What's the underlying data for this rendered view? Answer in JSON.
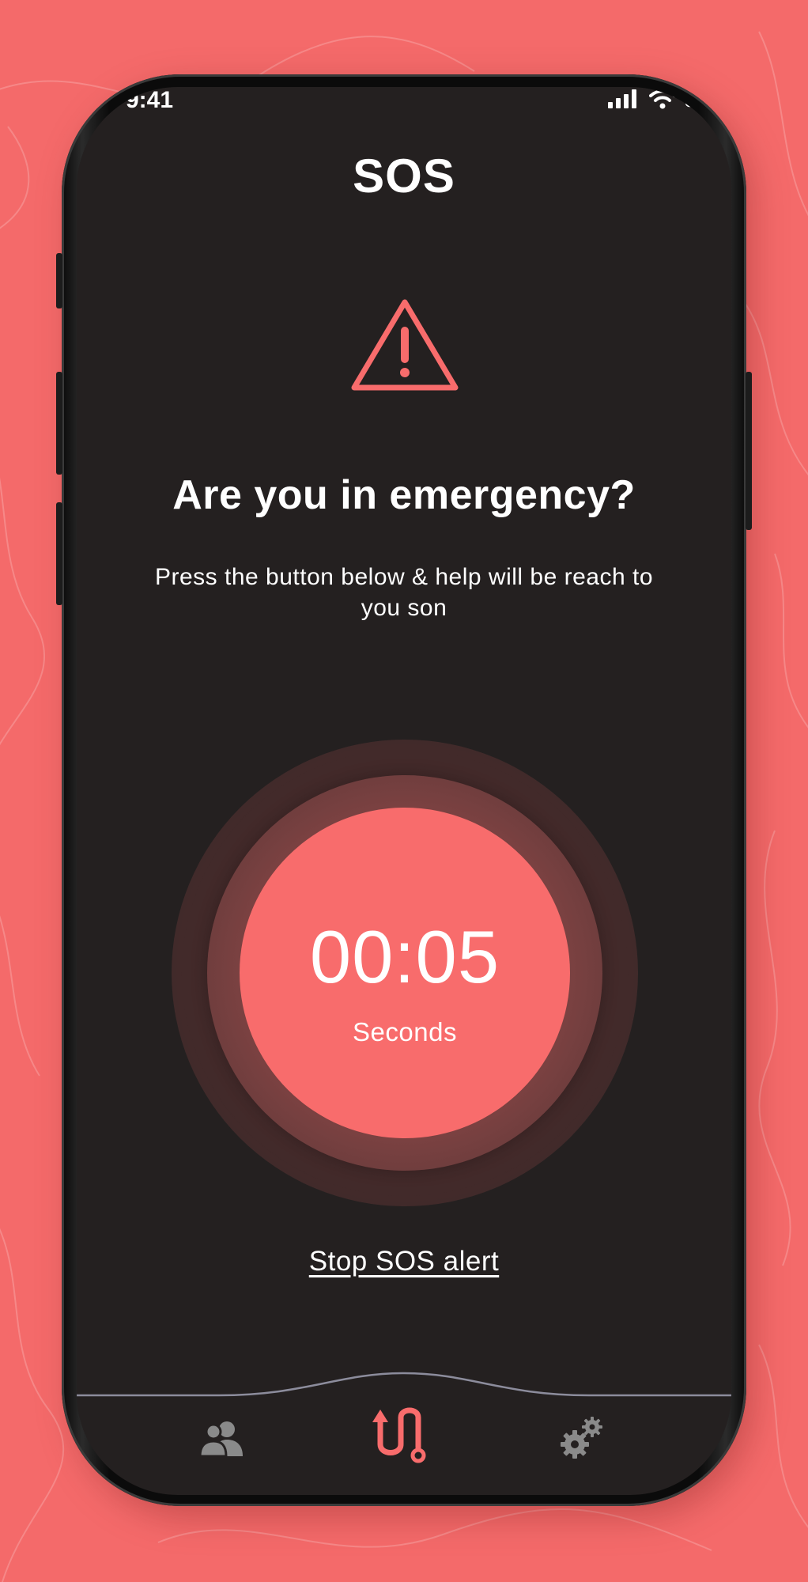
{
  "status_bar": {
    "time": "9:41",
    "icons": [
      "signal-icon",
      "wifi-icon",
      "battery-icon"
    ]
  },
  "header": {
    "title": "SOS"
  },
  "alert": {
    "icon": "warning-icon",
    "headline": "Are you in emergency?",
    "description": "Press the button below & help will be reach to you son"
  },
  "countdown": {
    "time": "00:05",
    "unit": "Seconds"
  },
  "actions": {
    "stop_label": "Stop SOS alert"
  },
  "bottom_nav": {
    "items": [
      {
        "icon": "contacts-icon",
        "active": false
      },
      {
        "icon": "route-icon",
        "active": true
      },
      {
        "icon": "settings-icon",
        "active": false
      }
    ]
  },
  "colors": {
    "background": "#F46A6A",
    "screen": "#242020",
    "accent": "#F86C6C",
    "text": "#FFFFFF",
    "nav_inactive": "#8A8A8A"
  }
}
